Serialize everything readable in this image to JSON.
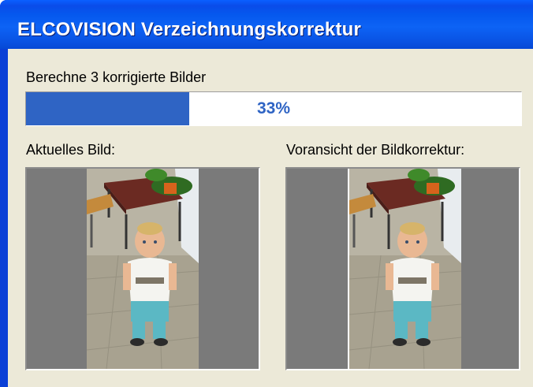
{
  "window": {
    "title": "ELCOVISION Verzeichnungskorrektur"
  },
  "status": {
    "text": "Berechne 3 korrigierte Bilder"
  },
  "progress": {
    "percent": 33,
    "label": "33%",
    "fill_color": "#2f64c4"
  },
  "panels": {
    "current_label": "Aktuelles Bild:",
    "preview_label": "Voransicht der Bildkorrektur:"
  },
  "colors": {
    "title_bar": "#0a55e6",
    "client_bg": "#ece9d8",
    "frame_bg": "#7a7a7a"
  }
}
